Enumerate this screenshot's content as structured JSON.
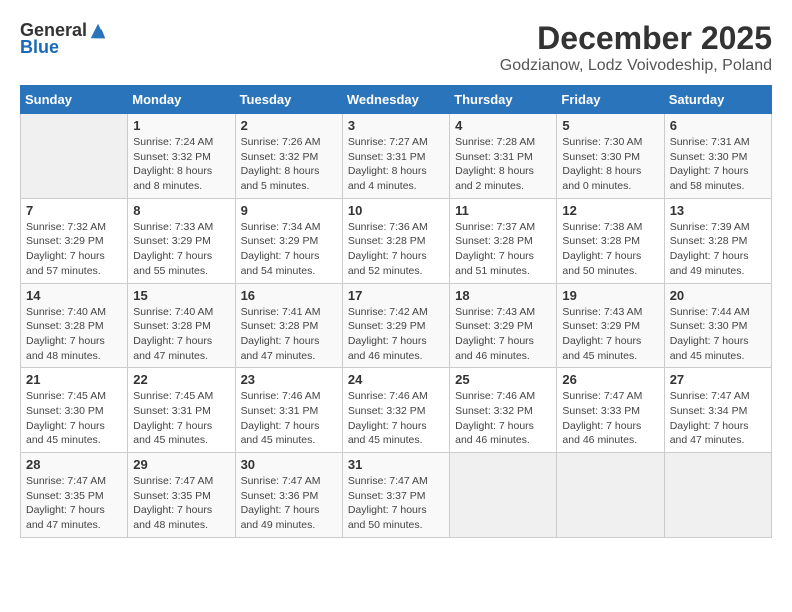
{
  "logo": {
    "general": "General",
    "blue": "Blue"
  },
  "title": "December 2025",
  "location": "Godzianow, Lodz Voivodeship, Poland",
  "days_of_week": [
    "Sunday",
    "Monday",
    "Tuesday",
    "Wednesday",
    "Thursday",
    "Friday",
    "Saturday"
  ],
  "weeks": [
    [
      {
        "day": "",
        "sunrise": "",
        "sunset": "",
        "daylight": "",
        "empty": true
      },
      {
        "day": "1",
        "sunrise": "Sunrise: 7:24 AM",
        "sunset": "Sunset: 3:32 PM",
        "daylight": "Daylight: 8 hours and 8 minutes."
      },
      {
        "day": "2",
        "sunrise": "Sunrise: 7:26 AM",
        "sunset": "Sunset: 3:32 PM",
        "daylight": "Daylight: 8 hours and 5 minutes."
      },
      {
        "day": "3",
        "sunrise": "Sunrise: 7:27 AM",
        "sunset": "Sunset: 3:31 PM",
        "daylight": "Daylight: 8 hours and 4 minutes."
      },
      {
        "day": "4",
        "sunrise": "Sunrise: 7:28 AM",
        "sunset": "Sunset: 3:31 PM",
        "daylight": "Daylight: 8 hours and 2 minutes."
      },
      {
        "day": "5",
        "sunrise": "Sunrise: 7:30 AM",
        "sunset": "Sunset: 3:30 PM",
        "daylight": "Daylight: 8 hours and 0 minutes."
      },
      {
        "day": "6",
        "sunrise": "Sunrise: 7:31 AM",
        "sunset": "Sunset: 3:30 PM",
        "daylight": "Daylight: 7 hours and 58 minutes."
      }
    ],
    [
      {
        "day": "7",
        "sunrise": "Sunrise: 7:32 AM",
        "sunset": "Sunset: 3:29 PM",
        "daylight": "Daylight: 7 hours and 57 minutes."
      },
      {
        "day": "8",
        "sunrise": "Sunrise: 7:33 AM",
        "sunset": "Sunset: 3:29 PM",
        "daylight": "Daylight: 7 hours and 55 minutes."
      },
      {
        "day": "9",
        "sunrise": "Sunrise: 7:34 AM",
        "sunset": "Sunset: 3:29 PM",
        "daylight": "Daylight: 7 hours and 54 minutes."
      },
      {
        "day": "10",
        "sunrise": "Sunrise: 7:36 AM",
        "sunset": "Sunset: 3:28 PM",
        "daylight": "Daylight: 7 hours and 52 minutes."
      },
      {
        "day": "11",
        "sunrise": "Sunrise: 7:37 AM",
        "sunset": "Sunset: 3:28 PM",
        "daylight": "Daylight: 7 hours and 51 minutes."
      },
      {
        "day": "12",
        "sunrise": "Sunrise: 7:38 AM",
        "sunset": "Sunset: 3:28 PM",
        "daylight": "Daylight: 7 hours and 50 minutes."
      },
      {
        "day": "13",
        "sunrise": "Sunrise: 7:39 AM",
        "sunset": "Sunset: 3:28 PM",
        "daylight": "Daylight: 7 hours and 49 minutes."
      }
    ],
    [
      {
        "day": "14",
        "sunrise": "Sunrise: 7:40 AM",
        "sunset": "Sunset: 3:28 PM",
        "daylight": "Daylight: 7 hours and 48 minutes."
      },
      {
        "day": "15",
        "sunrise": "Sunrise: 7:40 AM",
        "sunset": "Sunset: 3:28 PM",
        "daylight": "Daylight: 7 hours and 47 minutes."
      },
      {
        "day": "16",
        "sunrise": "Sunrise: 7:41 AM",
        "sunset": "Sunset: 3:28 PM",
        "daylight": "Daylight: 7 hours and 47 minutes."
      },
      {
        "day": "17",
        "sunrise": "Sunrise: 7:42 AM",
        "sunset": "Sunset: 3:29 PM",
        "daylight": "Daylight: 7 hours and 46 minutes."
      },
      {
        "day": "18",
        "sunrise": "Sunrise: 7:43 AM",
        "sunset": "Sunset: 3:29 PM",
        "daylight": "Daylight: 7 hours and 46 minutes."
      },
      {
        "day": "19",
        "sunrise": "Sunrise: 7:43 AM",
        "sunset": "Sunset: 3:29 PM",
        "daylight": "Daylight: 7 hours and 45 minutes."
      },
      {
        "day": "20",
        "sunrise": "Sunrise: 7:44 AM",
        "sunset": "Sunset: 3:30 PM",
        "daylight": "Daylight: 7 hours and 45 minutes."
      }
    ],
    [
      {
        "day": "21",
        "sunrise": "Sunrise: 7:45 AM",
        "sunset": "Sunset: 3:30 PM",
        "daylight": "Daylight: 7 hours and 45 minutes."
      },
      {
        "day": "22",
        "sunrise": "Sunrise: 7:45 AM",
        "sunset": "Sunset: 3:31 PM",
        "daylight": "Daylight: 7 hours and 45 minutes."
      },
      {
        "day": "23",
        "sunrise": "Sunrise: 7:46 AM",
        "sunset": "Sunset: 3:31 PM",
        "daylight": "Daylight: 7 hours and 45 minutes."
      },
      {
        "day": "24",
        "sunrise": "Sunrise: 7:46 AM",
        "sunset": "Sunset: 3:32 PM",
        "daylight": "Daylight: 7 hours and 45 minutes."
      },
      {
        "day": "25",
        "sunrise": "Sunrise: 7:46 AM",
        "sunset": "Sunset: 3:32 PM",
        "daylight": "Daylight: 7 hours and 46 minutes."
      },
      {
        "day": "26",
        "sunrise": "Sunrise: 7:47 AM",
        "sunset": "Sunset: 3:33 PM",
        "daylight": "Daylight: 7 hours and 46 minutes."
      },
      {
        "day": "27",
        "sunrise": "Sunrise: 7:47 AM",
        "sunset": "Sunset: 3:34 PM",
        "daylight": "Daylight: 7 hours and 47 minutes."
      }
    ],
    [
      {
        "day": "28",
        "sunrise": "Sunrise: 7:47 AM",
        "sunset": "Sunset: 3:35 PM",
        "daylight": "Daylight: 7 hours and 47 minutes."
      },
      {
        "day": "29",
        "sunrise": "Sunrise: 7:47 AM",
        "sunset": "Sunset: 3:35 PM",
        "daylight": "Daylight: 7 hours and 48 minutes."
      },
      {
        "day": "30",
        "sunrise": "Sunrise: 7:47 AM",
        "sunset": "Sunset: 3:36 PM",
        "daylight": "Daylight: 7 hours and 49 minutes."
      },
      {
        "day": "31",
        "sunrise": "Sunrise: 7:47 AM",
        "sunset": "Sunset: 3:37 PM",
        "daylight": "Daylight: 7 hours and 50 minutes."
      },
      {
        "day": "",
        "sunrise": "",
        "sunset": "",
        "daylight": "",
        "empty": true
      },
      {
        "day": "",
        "sunrise": "",
        "sunset": "",
        "daylight": "",
        "empty": true
      },
      {
        "day": "",
        "sunrise": "",
        "sunset": "",
        "daylight": "",
        "empty": true
      }
    ]
  ]
}
